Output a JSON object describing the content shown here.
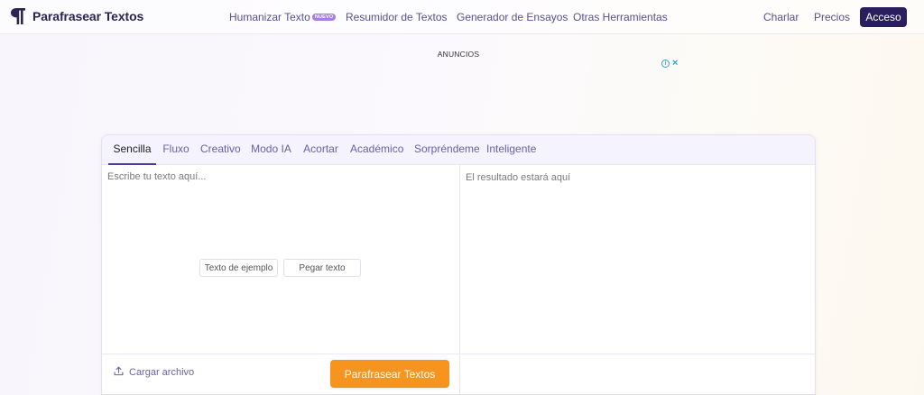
{
  "header": {
    "brand": "Parafrasear Textos",
    "nav": [
      {
        "label": "Humanizar Texto",
        "badge": "NUEVO"
      },
      {
        "label": "Resumidor de Textos"
      },
      {
        "label": "Generador de Ensayos"
      },
      {
        "label": "Otras Herramientas"
      }
    ],
    "right_links": [
      "Charlar",
      "Precios"
    ],
    "login_label": "Acceso"
  },
  "ads": {
    "label": "ANUNCIOS",
    "info_icon": "info-icon",
    "close_icon": "close-icon"
  },
  "tabs": [
    "Sencilla",
    "Fluxo",
    "Creativo",
    "Modo IA",
    "Acortar",
    "Académico",
    "Sorpréndeme",
    "Inteligente"
  ],
  "active_tab": "Sencilla",
  "editor": {
    "input_placeholder": "Escribe tu texto aquí...",
    "output_placeholder": "El resultado estará aquí",
    "sample_button": "Texto de ejemplo",
    "paste_button": "Pegar texto",
    "upload_label": "Cargar archivo",
    "submit_label": "Parafrasear Textos"
  },
  "colors": {
    "primary": "#2a1f5e",
    "accent": "#f7941d",
    "badge": "#a57ee0",
    "link": "#5a4f92"
  }
}
